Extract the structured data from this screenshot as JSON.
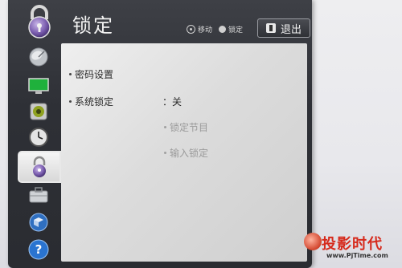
{
  "header": {
    "title": "锁定",
    "hint_move": "移动",
    "hint_lock": "锁定",
    "exit_label": "退出"
  },
  "sidebar": {
    "items": [
      {
        "icon": "satellite-dish-icon"
      },
      {
        "icon": "tv-screen-icon"
      },
      {
        "icon": "speaker-icon"
      },
      {
        "icon": "clock-icon"
      },
      {
        "icon": "padlock-icon",
        "active": true
      },
      {
        "icon": "toolbox-icon"
      },
      {
        "icon": "network-cube-icon"
      },
      {
        "icon": "help-icon"
      }
    ]
  },
  "panel": {
    "password_setting": "密码设置",
    "system_lock_label": "系统锁定",
    "system_lock_value": "：关",
    "lock_program": "锁定节目",
    "input_lock": "输入锁定"
  },
  "watermark": {
    "brand": "投影时代",
    "url": "www.PjTime.com"
  },
  "colors": {
    "frame": "#2e3036",
    "panel": "#dcdcdc",
    "brand_red": "#d62a1c"
  }
}
